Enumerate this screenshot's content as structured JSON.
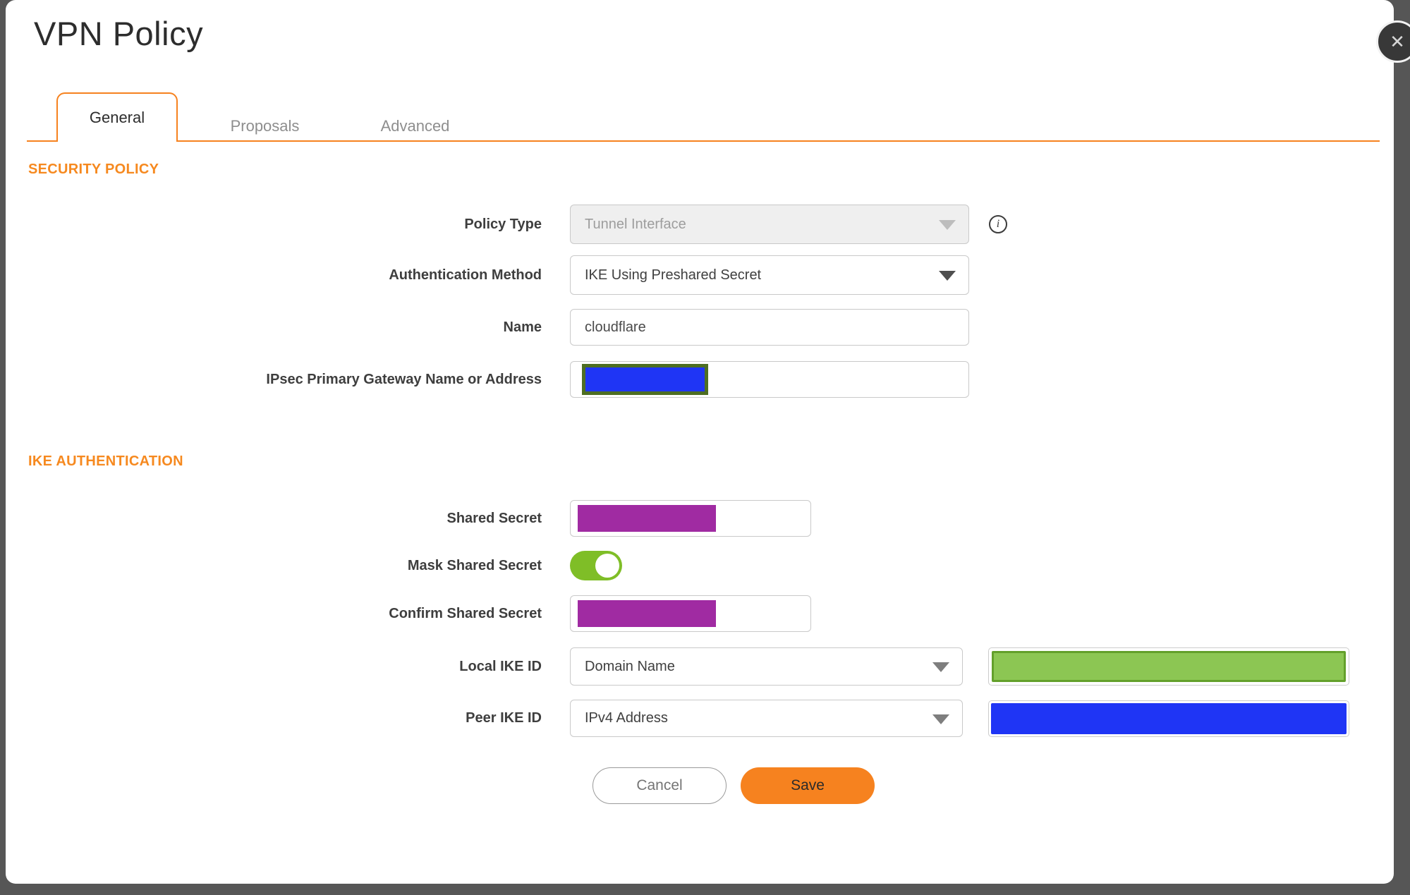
{
  "window": {
    "title": "VPN Policy"
  },
  "icons": {
    "close": "✕",
    "info": "i"
  },
  "tabs": {
    "items": [
      {
        "label": "General",
        "active": true
      },
      {
        "label": "Proposals",
        "active": false
      },
      {
        "label": "Advanced",
        "active": false
      }
    ]
  },
  "security_policy": {
    "heading": "SECURITY POLICY",
    "policy_type_label": "Policy Type",
    "policy_type_value": "Tunnel Interface",
    "policy_type_disabled": true,
    "auth_method_label": "Authentication Method",
    "auth_method_value": "IKE Using Preshared Secret",
    "name_label": "Name",
    "name_value": "cloudflare",
    "gateway_label": "IPsec Primary Gateway Name or Address",
    "gateway_value_redacted": true
  },
  "ike_authentication": {
    "heading": "IKE AUTHENTICATION",
    "shared_secret_label": "Shared Secret",
    "shared_secret_redacted": true,
    "mask_shared_secret_label": "Mask Shared Secret",
    "mask_shared_secret_on": true,
    "confirm_shared_secret_label": "Confirm Shared Secret",
    "confirm_shared_secret_redacted": true,
    "local_ike_id_label": "Local IKE ID",
    "local_ike_id_type": "Domain Name",
    "local_ike_id_value_redacted": true,
    "peer_ike_id_label": "Peer IKE ID",
    "peer_ike_id_type": "IPv4 Address",
    "peer_ike_id_value_redacted": true
  },
  "actions": {
    "cancel_label": "Cancel",
    "save_label": "Save"
  },
  "colors": {
    "accent_orange": "#F6821F",
    "heading_orange": "#F6891F",
    "toggle_green": "#7FBE27",
    "redaction_purple": "#A02BA2",
    "redaction_blue": "#1F35F5",
    "redaction_green_fill": "#8CC653",
    "redaction_green_border": "#63A02B",
    "gateway_redaction_border": "#4E6E22",
    "backdrop_gray": "#565656"
  }
}
